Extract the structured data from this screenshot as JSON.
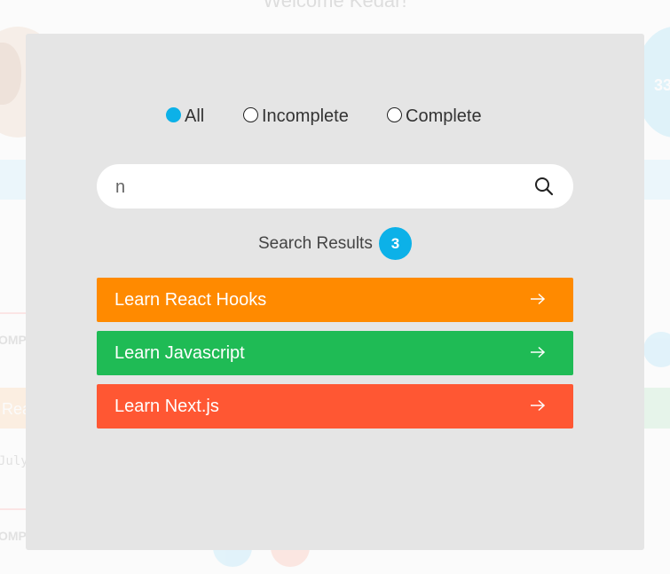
{
  "background": {
    "welcome_text": "Welcome Kedar!",
    "counter_value": "33",
    "completed_label_1": "OMP",
    "completed_label_2": "OMP",
    "card_title_fragment": "Rea",
    "date_fragment": "July"
  },
  "filters": {
    "options": [
      {
        "label": "All",
        "checked": true
      },
      {
        "label": "Incomplete",
        "checked": false
      },
      {
        "label": "Complete",
        "checked": false
      }
    ]
  },
  "search": {
    "value": "n",
    "icon": "search-icon"
  },
  "results": {
    "label": "Search Results",
    "count": "3",
    "items": [
      {
        "label": "Learn React Hooks",
        "color": "#ff8a00"
      },
      {
        "label": "Learn Javascript",
        "color": "#1fbb55"
      },
      {
        "label": "Learn Next.js",
        "color": "#ff5733"
      }
    ]
  },
  "colors": {
    "accent": "#0cb1e8",
    "modal_bg": "#e5e5e5"
  }
}
